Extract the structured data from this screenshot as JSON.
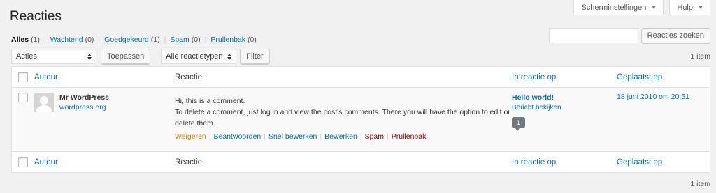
{
  "screen_meta": {
    "screen_options": "Scherminstellingen",
    "help": "Hulp"
  },
  "page_title": "Reacties",
  "filters": [
    {
      "label": "Alles",
      "count": "(1)",
      "current": true
    },
    {
      "label": "Wachtend",
      "count": "(0)",
      "current": false
    },
    {
      "label": "Goedgekeurd",
      "count": "(1)",
      "current": false
    },
    {
      "label": "Spam",
      "count": "(0)",
      "current": false
    },
    {
      "label": "Prullenbak",
      "count": "(0)",
      "current": false
    }
  ],
  "search": {
    "value": "",
    "button": "Reacties zoeken"
  },
  "tablenav": {
    "bulk_actions": "Acties",
    "apply": "Toepassen",
    "type_filter": "Alle reactietypen",
    "filter": "Filter",
    "count_top": "1 item",
    "count_bottom": "1 item"
  },
  "columns": {
    "author": "Auteur",
    "comment": "Reactie",
    "response": "In reactie op",
    "date": "Geplaatst op"
  },
  "comments": [
    {
      "author_name": "Mr WordPress",
      "author_url": "wordpress.org",
      "text_line1": "Hi, this is a comment.",
      "text_line2": "To delete a comment, just log in and view the post's comments. There you will have the option to edit or delete them.",
      "actions": {
        "unapprove": "Weigeren",
        "reply": "Beantwoorden",
        "quick_edit": "Snel bewerken",
        "edit": "Bewerken",
        "spam": "Spam",
        "trash": "Prullenbak"
      },
      "response_title": "Hello world!",
      "response_view": "Bericht bekijken",
      "response_count": "1",
      "date": "18 juni 2010 om 20:51"
    }
  ],
  "colors": {
    "link": "#0073aa",
    "unapprove": "#d98500",
    "delete": "#a00000",
    "background": "#f1f1f1"
  }
}
